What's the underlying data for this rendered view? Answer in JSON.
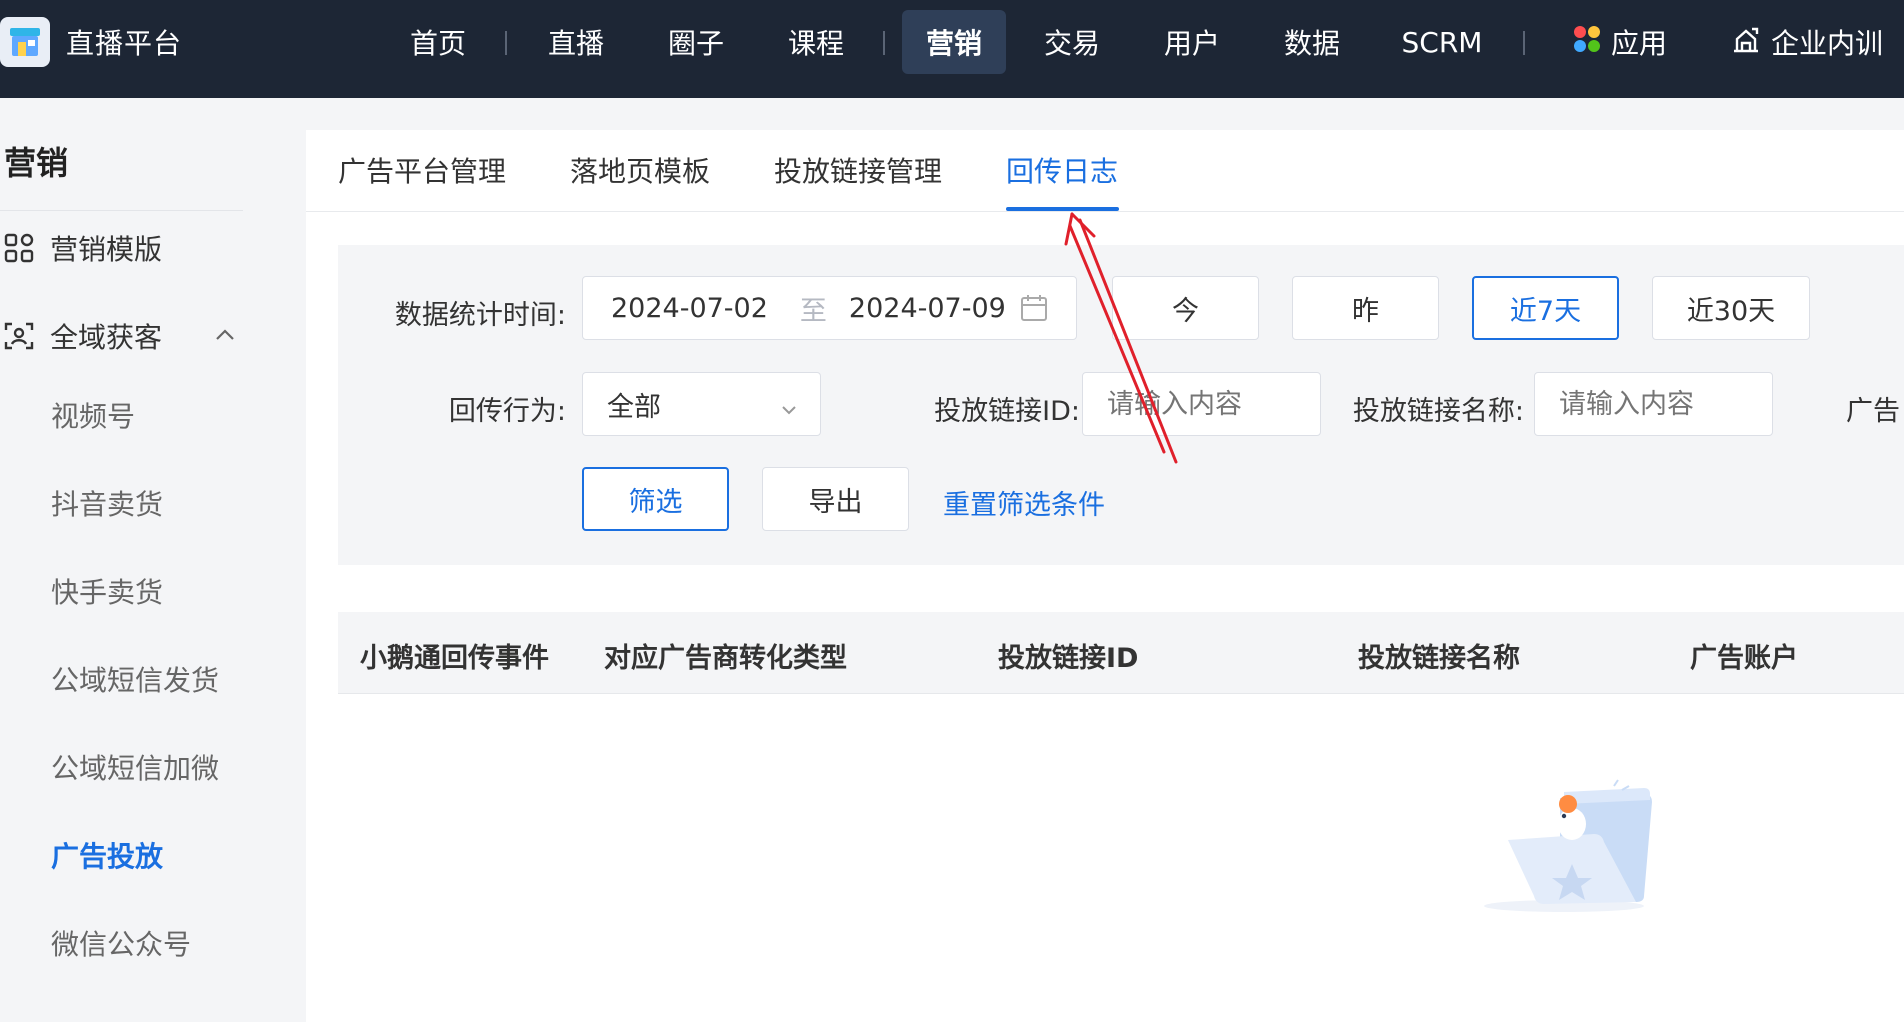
{
  "brand": {
    "name": "直播平台"
  },
  "nav": [
    {
      "label": "首页"
    },
    {
      "label": "直播"
    },
    {
      "label": "圈子"
    },
    {
      "label": "课程"
    },
    {
      "label": "营销"
    },
    {
      "label": "交易"
    },
    {
      "label": "用户"
    },
    {
      "label": "数据"
    },
    {
      "label": "SCRM"
    },
    {
      "label": "应用"
    },
    {
      "label": "企业内训"
    }
  ],
  "sidebar": {
    "title": "营销",
    "items": [
      {
        "label": "营销模版",
        "icon": "grid-apps-icon"
      },
      {
        "label": "全域获客",
        "icon": "user-scan-icon",
        "expanded": true
      }
    ],
    "sub_items": [
      {
        "label": "视频号"
      },
      {
        "label": "抖音卖货"
      },
      {
        "label": "快手卖货"
      },
      {
        "label": "公域短信发货"
      },
      {
        "label": "公域短信加微"
      },
      {
        "label": "广告投放",
        "active": true
      },
      {
        "label": "微信公众号"
      }
    ]
  },
  "tabs": [
    {
      "label": "广告平台管理"
    },
    {
      "label": "落地页模板"
    },
    {
      "label": "投放链接管理"
    },
    {
      "label": "回传日志",
      "active": true
    }
  ],
  "filters": {
    "time_label": "数据统计时间:",
    "date_start": "2024-07-02",
    "date_sep": "至",
    "date_end": "2024-07-09",
    "quick_today": "今",
    "quick_yesterday": "昨",
    "quick_7d": "近7天",
    "quick_30d": "近30天",
    "behavior_label": "回传行为:",
    "behavior_value": "全部",
    "link_id_label": "投放链接ID:",
    "link_id_placeholder": "请输入内容",
    "link_name_label": "投放链接名称:",
    "link_name_placeholder": "请输入内容",
    "account_label_partial": "广告",
    "btn_filter": "筛选",
    "btn_export": "导出",
    "btn_reset": "重置筛选条件"
  },
  "table": {
    "columns": [
      "小鹅通回传事件",
      "对应广告商转化类型",
      "投放链接ID",
      "投放链接名称",
      "广告账户"
    ]
  },
  "colors": {
    "topbar": "#1d2635",
    "accent": "#1a6fe0",
    "annotation_arrow": "#e0202b"
  }
}
